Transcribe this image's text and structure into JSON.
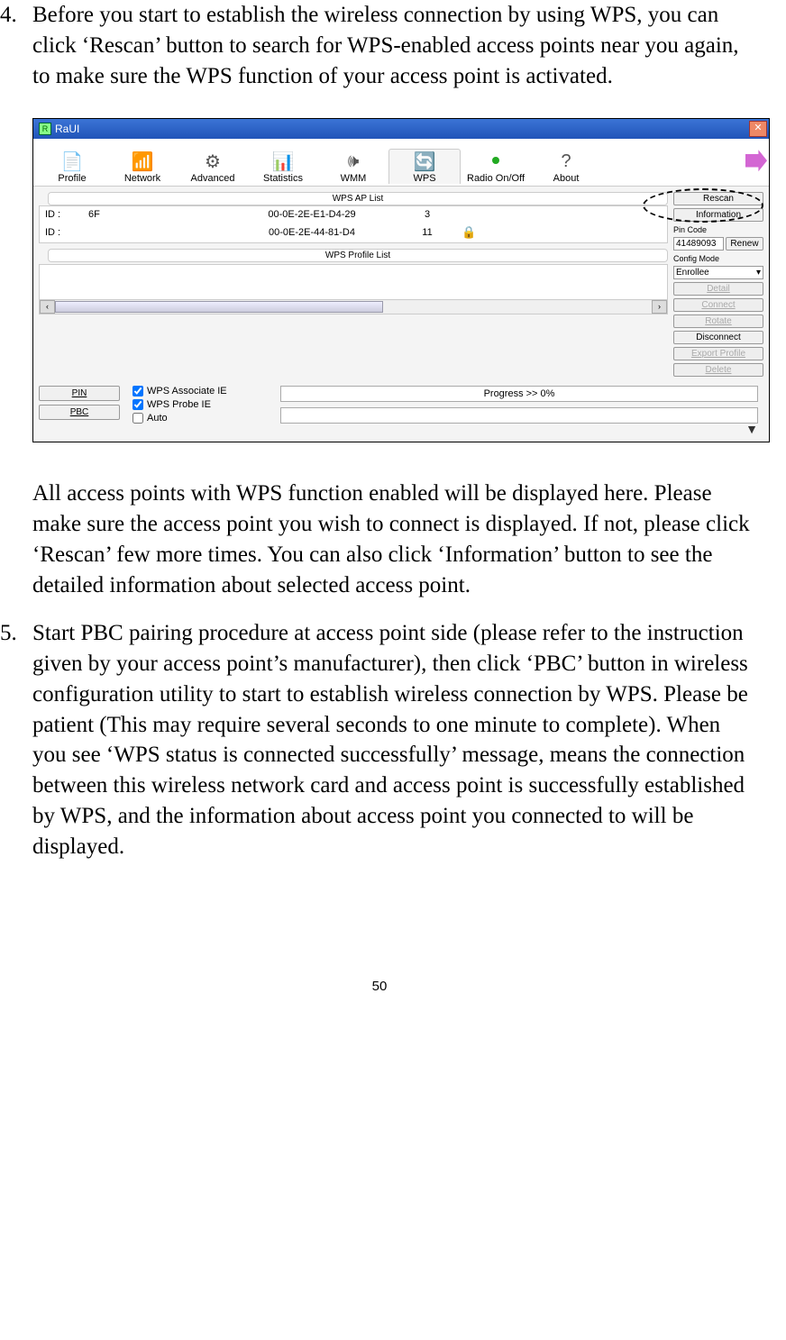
{
  "items": [
    {
      "num": "4.",
      "text": "Before you start to establish the wireless connection by using WPS, you can click ‘Rescan’ button to search for WPS-enabled access points near you again, to make sure the WPS function of your access point is activated."
    },
    {
      "after": "All access points with WPS function enabled will be displayed here. Please make sure the access point you wish to connect is displayed. If not, please click ‘Rescan’ few more times. You can also click ‘Information’ button to see the detailed information about selected access point."
    },
    {
      "num": "5.",
      "text": "Start PBC pairing procedure at access point side (please refer to the instruction given by your access point’s manufacturer), then click ‘PBC’ button in wireless configuration utility to start to establish wireless connection by WPS. Please be patient (This may require several seconds to one minute to complete). When you see ‘WPS status is connected successfully’ message, means the connection between this wireless network card and access point is successfully established by WPS, and the information about access point you connected to will be displayed."
    }
  ],
  "window": {
    "title": "RaUI",
    "toolbar": [
      "Profile",
      "Network",
      "Advanced",
      "Statistics",
      "WMM",
      "WPS",
      "Radio On/Off",
      "About"
    ],
    "section1": "WPS AP List",
    "section2": "WPS Profile List",
    "aplist": [
      {
        "c1": "ID :",
        "c2": "6F",
        "c3": "00-0E-2E-E1-D4-29",
        "c4": "3",
        "lock": false
      },
      {
        "c1": "ID :",
        "c2": "",
        "c3": "00-0E-2E-44-81-D4",
        "c4": "11",
        "lock": true
      }
    ],
    "right": {
      "rescan": "Rescan",
      "information": "Information",
      "pincode_label": "Pin Code",
      "pincode_value": "41489093",
      "renew": "Renew",
      "config_label": "Config Mode",
      "config_value": "Enrollee",
      "detail": "Detail",
      "connect": "Connect",
      "rotate": "Rotate",
      "disconnect": "Disconnect",
      "export": "Export Profile",
      "delete": "Delete"
    },
    "bottom": {
      "pin": "PIN",
      "pbc": "PBC",
      "cb1": "WPS Associate IE",
      "cb2": "WPS Probe IE",
      "cb3": "Auto",
      "progress": "Progress >> 0%"
    }
  },
  "pagenum": "50"
}
